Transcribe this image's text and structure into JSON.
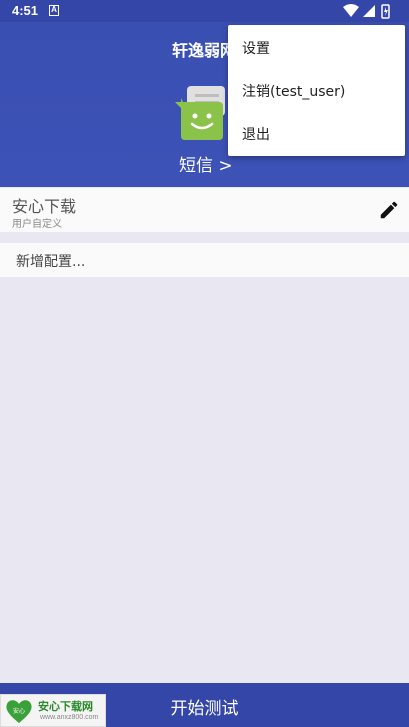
{
  "status_bar": {
    "time": "4:51",
    "notification_icon": "a-icon"
  },
  "header": {
    "title": "轩逸弱网",
    "sms_label": "短信 >"
  },
  "config": {
    "name": "安心下载",
    "subtitle": "用户自定义"
  },
  "add_config": {
    "label": "新增配置..."
  },
  "bottom": {
    "start_label": "开始测试"
  },
  "watermark": {
    "logo_text": "安心",
    "text": "安心下载网",
    "url": "www.anxz800.com"
  },
  "menu": {
    "items": [
      {
        "label": "设置"
      },
      {
        "label": "注销(test_user)"
      },
      {
        "label": "退出"
      }
    ]
  },
  "colors": {
    "primary": "#3447a8",
    "sms_icon_green": "#8bc34a",
    "background": "#e9e7f1"
  }
}
